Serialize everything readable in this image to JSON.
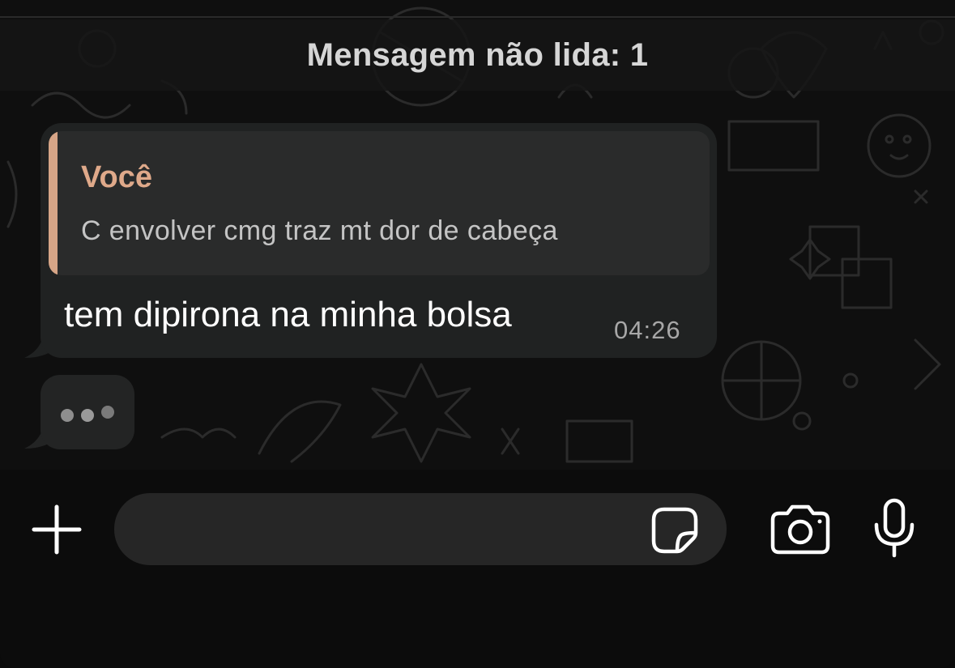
{
  "banner": {
    "unread_label": "Mensagem não lida: 1"
  },
  "message": {
    "quote": {
      "author": "Você",
      "text": "C envolver cmg traz mt dor de cabeça"
    },
    "text": "tem dipirona na minha bolsa",
    "time": "04:26"
  },
  "typing_indicator": {
    "dots": 3
  },
  "input_bar": {
    "placeholder": "",
    "icons": [
      "plus-icon",
      "sticker-icon",
      "camera-icon",
      "microphone-icon"
    ]
  },
  "colors": {
    "quote_accent": "#d6a587",
    "bubble": "#202222",
    "background": "#0f0f0f"
  }
}
